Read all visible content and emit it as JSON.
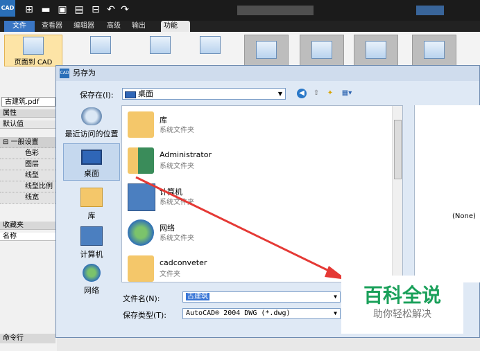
{
  "titlebar": {
    "logo_text": "CAD"
  },
  "menubar": {
    "items": [
      "文件",
      "查看器",
      "编辑器",
      "高级",
      "输出",
      "功能"
    ]
  },
  "ribbon": {
    "page_to_cad_label": "页面到 CAD"
  },
  "left_panel": {
    "file_tab": "古建筑.pdf",
    "properties_header": "属性",
    "default_header": "默认值",
    "general_settings": "一般设置",
    "rows": [
      "色彩",
      "图层",
      "线型",
      "线型比例",
      "线宽"
    ],
    "favorites_header": "收藏夹",
    "name_header": "名称",
    "command_line": "命令行"
  },
  "dialog": {
    "title": "另存为",
    "save_in_label": "保存在(I):",
    "save_in_value": "桌面",
    "places": [
      {
        "label": "最近访问的位置"
      },
      {
        "label": "桌面"
      },
      {
        "label": "库"
      },
      {
        "label": "计算机"
      },
      {
        "label": "网络"
      }
    ],
    "files": [
      {
        "name": "库",
        "desc": "系统文件夹"
      },
      {
        "name": "Administrator",
        "desc": "系统文件夹"
      },
      {
        "name": "计算机",
        "desc": "系统文件夹"
      },
      {
        "name": "网络",
        "desc": "系统文件夹"
      },
      {
        "name": "cadconveter",
        "desc": "文件夹"
      }
    ],
    "preview_text": "(None)",
    "filename_label": "文件名(N):",
    "filename_value": "古建筑",
    "filetype_label": "保存类型(T):",
    "filetype_value": "AutoCAD® 2004 DWG (*.dwg)"
  },
  "watermark": {
    "title": "百科全说",
    "subtitle": "助你轻松解决"
  },
  "colors": {
    "accent": "#3a76c4",
    "arrow": "#e53935",
    "watermark_green": "#1aa05a"
  }
}
